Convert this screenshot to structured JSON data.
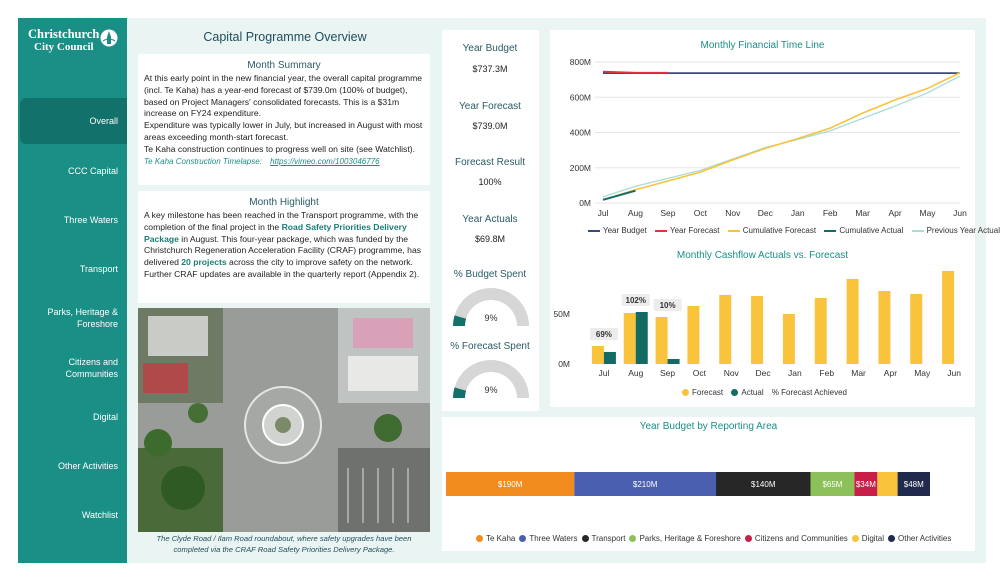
{
  "brand": {
    "line1": "Christchurch",
    "line2": "City Council"
  },
  "nav": [
    {
      "label": "Overall",
      "active": true
    },
    {
      "label": "CCC Capital"
    },
    {
      "label": "Three Waters"
    },
    {
      "label": "Transport"
    },
    {
      "label": "Parks, Heritage &\nForeshore"
    },
    {
      "label": "Citizens and\nCommunities"
    },
    {
      "label": "Digital"
    },
    {
      "label": "Other Activities"
    },
    {
      "label": "Watchlist"
    }
  ],
  "page_title": "Capital Programme Overview",
  "summary": {
    "title": "Month Summary",
    "p1": "At this early point in the new financial year, the overall capital programme (incl. Te Kaha) has a year-end forecast of $739.0m (100% of budget), based on Project Managers' consolidated forecasts. This is a $31m increase on FY24 expenditure.",
    "p2": "Expenditure was typically lower in July, but increased in August with most areas exceeding month-start forecast.",
    "p3": "Te Kaha construction continues to progress well on site (see Watchlist).",
    "link_label": "Te Kaha Construction Timelapse:",
    "link_url": "https://vimeo.com/1003046776"
  },
  "highlight": {
    "title": "Month Highlight",
    "t1": "A key milestone has been reached in the Transport programme, with the completion of the final project in the ",
    "b1": "Road Safety Priorities Delivery Package",
    "t2": " in August.  This four-year package, which was funded by the Christchurch Regeneration Acceleration Facility (CRAF) programme, has delivered ",
    "b2": "20 projects",
    "t3": " across the city to improve safety on the network.  Further CRAF updates are available in the quarterly report (Appendix 2)."
  },
  "photo_caption": "The Clyde Road / Ilam Road roundabout, where safety upgrades have been completed via the CRAF Road Safety Priorities Delivery Package.",
  "kpis": {
    "year_budget": {
      "label": "Year Budget",
      "value": "$737.3M"
    },
    "year_forecast": {
      "label": "Year Forecast",
      "value": "$739.0M"
    },
    "forecast_result": {
      "label": "Forecast Result",
      "value": "100%"
    },
    "year_actuals": {
      "label": "Year Actuals",
      "value": "$69.8M"
    },
    "budget_spent": {
      "label": "% Budget Spent",
      "value": "9%",
      "fraction": 0.09
    },
    "forecast_spent": {
      "label": "% Forecast Spent",
      "value": "9%",
      "fraction": 0.09
    }
  },
  "colors": {
    "teal": "#1a8f86",
    "dark_teal": "#13716b",
    "forecast": "#f9c33c",
    "actual": "#146b63",
    "budget_line": "#3b4a7a",
    "year_forecast_line": "#e0343a",
    "prev_year": "#a9dcd5"
  },
  "chart_data": [
    {
      "type": "line",
      "title": "Monthly Financial Time Line",
      "categories": [
        "Jul",
        "Aug",
        "Sep",
        "Oct",
        "Nov",
        "Dec",
        "Jan",
        "Feb",
        "Mar",
        "Apr",
        "May",
        "Jun"
      ],
      "y_ticks": [
        "0M",
        "200M",
        "400M",
        "600M",
        "800M"
      ],
      "ylim": [
        0,
        800
      ],
      "series": [
        {
          "name": "Year Budget",
          "values": [
            737,
            737,
            737,
            737,
            737,
            737,
            737,
            737,
            737,
            737,
            737,
            737
          ]
        },
        {
          "name": "Year Forecast",
          "values": [
            745,
            739,
            739
          ]
        },
        {
          "name": "Cumulative Forecast",
          "values": [
            18,
            75,
            125,
            175,
            245,
            310,
            365,
            425,
            510,
            585,
            650,
            739
          ]
        },
        {
          "name": "Cumulative Actual",
          "values": [
            18,
            70
          ]
        },
        {
          "name": "Previous Year Actual",
          "values": [
            35,
            95,
            140,
            185,
            250,
            315,
            360,
            410,
            480,
            550,
            625,
            720
          ]
        }
      ]
    },
    {
      "type": "bar",
      "title": "Monthly Cashflow Actuals vs. Forecast",
      "categories": [
        "Jul",
        "Aug",
        "Sep",
        "Oct",
        "Nov",
        "Dec",
        "Jan",
        "Feb",
        "Mar",
        "Apr",
        "May",
        "Jun"
      ],
      "y_ticks": [
        "0M",
        "50M"
      ],
      "ylim": [
        0,
        100
      ],
      "series": [
        {
          "name": "Forecast",
          "values": [
            18,
            51,
            47,
            58,
            69,
            68,
            50,
            66,
            85,
            73,
            70,
            93
          ]
        },
        {
          "name": "Actual",
          "values": [
            12,
            52,
            5,
            null,
            null,
            null,
            null,
            null,
            null,
            null,
            null,
            null
          ]
        },
        {
          "name": "% Forecast Achieved",
          "labels": [
            "69%",
            "102%",
            "10%"
          ]
        }
      ]
    },
    {
      "type": "bar",
      "title": "Year Budget by Reporting Area",
      "stacked": true,
      "series": [
        {
          "name": "Te Kaha",
          "value": 190,
          "label": "$190M",
          "color": "#f28c1e"
        },
        {
          "name": "Three Waters",
          "value": 210,
          "label": "$210M",
          "color": "#4a5fb0"
        },
        {
          "name": "Transport",
          "value": 140,
          "label": "$140M",
          "color": "#272727"
        },
        {
          "name": "Parks, Heritage & Foreshore",
          "value": 65,
          "label": "$65M",
          "color": "#8cc15a"
        },
        {
          "name": "Citizens and Communities",
          "value": 34,
          "label": "$34M",
          "color": "#c81e4a"
        },
        {
          "name": "Digital",
          "value": 30,
          "label": "",
          "color": "#f9c33c"
        },
        {
          "name": "Other Activities",
          "value": 48,
          "label": "$48M",
          "color": "#1f2a4d"
        }
      ]
    }
  ]
}
